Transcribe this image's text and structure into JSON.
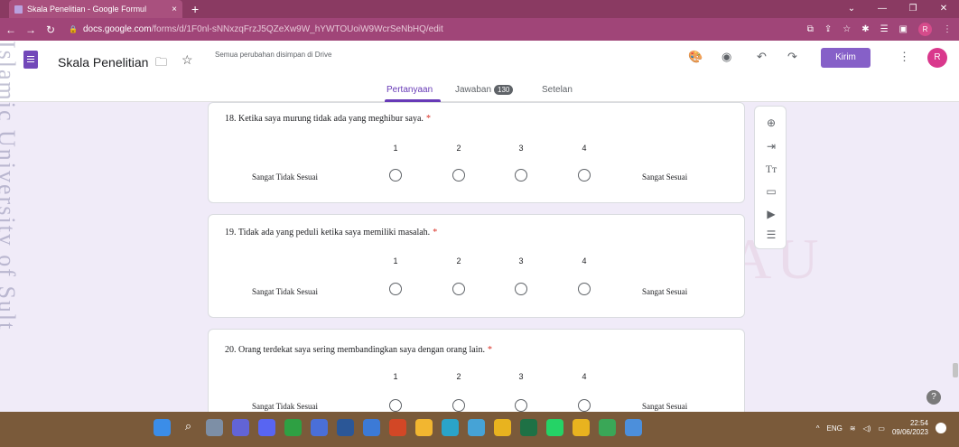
{
  "browser": {
    "tab_title": "Skala Penelitian - Google Formul",
    "tab_close": "×",
    "new_tab": "+",
    "url_host": "docs.google.com",
    "url_path": "/forms/d/1F0nl-sNNxzqFrzJ5QZeXw9W_hYWTOUoiW9WcrSeNbHQ/edit",
    "profile_initial": "R"
  },
  "form_header": {
    "title": "Skala Penelitian",
    "saved_status": "Semua perubahan disimpan di Drive",
    "send_label": "Kirim",
    "avatar_initial": "R"
  },
  "tabs": [
    {
      "label": "Pertanyaan",
      "active": true
    },
    {
      "label": "Jawaban",
      "badge": "130"
    },
    {
      "label": "Setelan"
    }
  ],
  "scale": {
    "numbers": [
      "1",
      "2",
      "3",
      "4"
    ],
    "low_label": "Sangat Tidak Sesuai",
    "high_label": "Sangat Sesuai"
  },
  "questions": [
    {
      "text": "18. Ketika saya murung tidak ada yang meghibur saya.",
      "required": "*"
    },
    {
      "text": "19. Tidak ada yang peduli ketika saya memiliki masalah.",
      "required": "*"
    },
    {
      "text": "20. Orang terdekat saya sering membandingkan saya dengan orang lain.",
      "required": "*"
    }
  ],
  "toolbar_icons": [
    "add-question-icon",
    "import-questions-icon",
    "add-title-icon",
    "add-image-icon",
    "add-video-icon",
    "add-section-icon"
  ],
  "watermark": "UIN SUSKA RIAU",
  "side_watermark": "Islamic University of Sult",
  "taskbar": {
    "lang": "ENG",
    "time": "22:54",
    "date": "09/06/2023"
  },
  "colors": {
    "accent": "#673ab7",
    "send_button": "#8660c8",
    "background": "#f0ebf8",
    "required": "#d93025"
  }
}
